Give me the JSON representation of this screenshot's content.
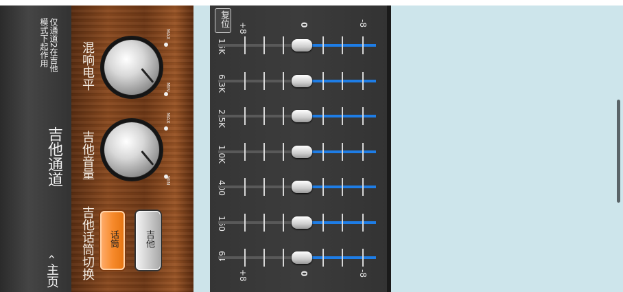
{
  "header": {
    "back_label": "主页",
    "title": "吉他通道",
    "note": [
      "仅通道2在吉他",
      "模式下起作用"
    ]
  },
  "input_switch": {
    "title": "吉他话筒切换",
    "mic_label": "话筒",
    "guitar_label": "吉他",
    "selected": "话筒"
  },
  "knobs": {
    "guitar_volume": {
      "label": "吉他音量",
      "min_label": "MIN",
      "max_label": "MAX"
    },
    "reverb_level": {
      "label": "混响电平",
      "min_label": "MIN",
      "max_label": "MAX"
    }
  },
  "eq": {
    "reset_label": "复位",
    "scale_top": "+8",
    "scale_zero": "0",
    "scale_bottom": "-8",
    "bands": [
      {
        "freq": "64",
        "gain": 0
      },
      {
        "freq": "160",
        "gain": 0
      },
      {
        "freq": "400",
        "gain": 0
      },
      {
        "freq": "1.0K",
        "gain": 0
      },
      {
        "freq": "2.5K",
        "gain": 0
      },
      {
        "freq": "6.3K",
        "gain": 0
      },
      {
        "freq": "15K",
        "gain": 0
      }
    ]
  },
  "colors": {
    "header_bg": "#3a3a3a",
    "accent_orange": "#f78a2c",
    "slider_blue": "#1e7de6",
    "panel_light": "#cde5eb"
  },
  "icons": {
    "back": "chevron-left-icon"
  }
}
